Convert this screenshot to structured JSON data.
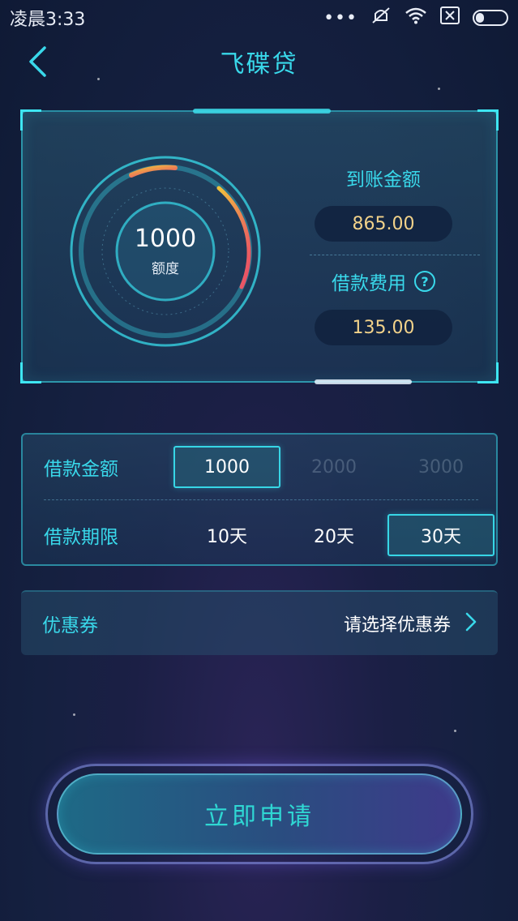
{
  "status_bar": {
    "time": "凌晨3:33",
    "icons": [
      "more-dots-icon",
      "silent-icon",
      "wifi-icon",
      "sim-x-icon",
      "battery-icon"
    ]
  },
  "nav": {
    "title": "飞碟贷",
    "back_icon": "chevron-left-icon"
  },
  "summary": {
    "gauge_amount": "1000",
    "gauge_label": "额度",
    "received_label": "到账金额",
    "received_value": "865.00",
    "fee_label": "借款费用",
    "fee_help_icon": "question-circle-icon",
    "fee_value": "135.00"
  },
  "loan": {
    "amount_label": "借款金额",
    "amount_options": [
      "1000",
      "2000",
      "3000"
    ],
    "amount_selected": "1000",
    "term_label": "借款期限",
    "term_options": [
      "10天",
      "20天",
      "30天"
    ],
    "term_selected": "30天"
  },
  "coupon": {
    "label": "优惠券",
    "value": "请选择优惠券",
    "chevron_icon": "chevron-right-icon"
  },
  "apply_button": {
    "label": "立即申请"
  },
  "colors": {
    "accent": "#39d8ea",
    "amount_text": "#f2d28a",
    "background": "#152040"
  }
}
